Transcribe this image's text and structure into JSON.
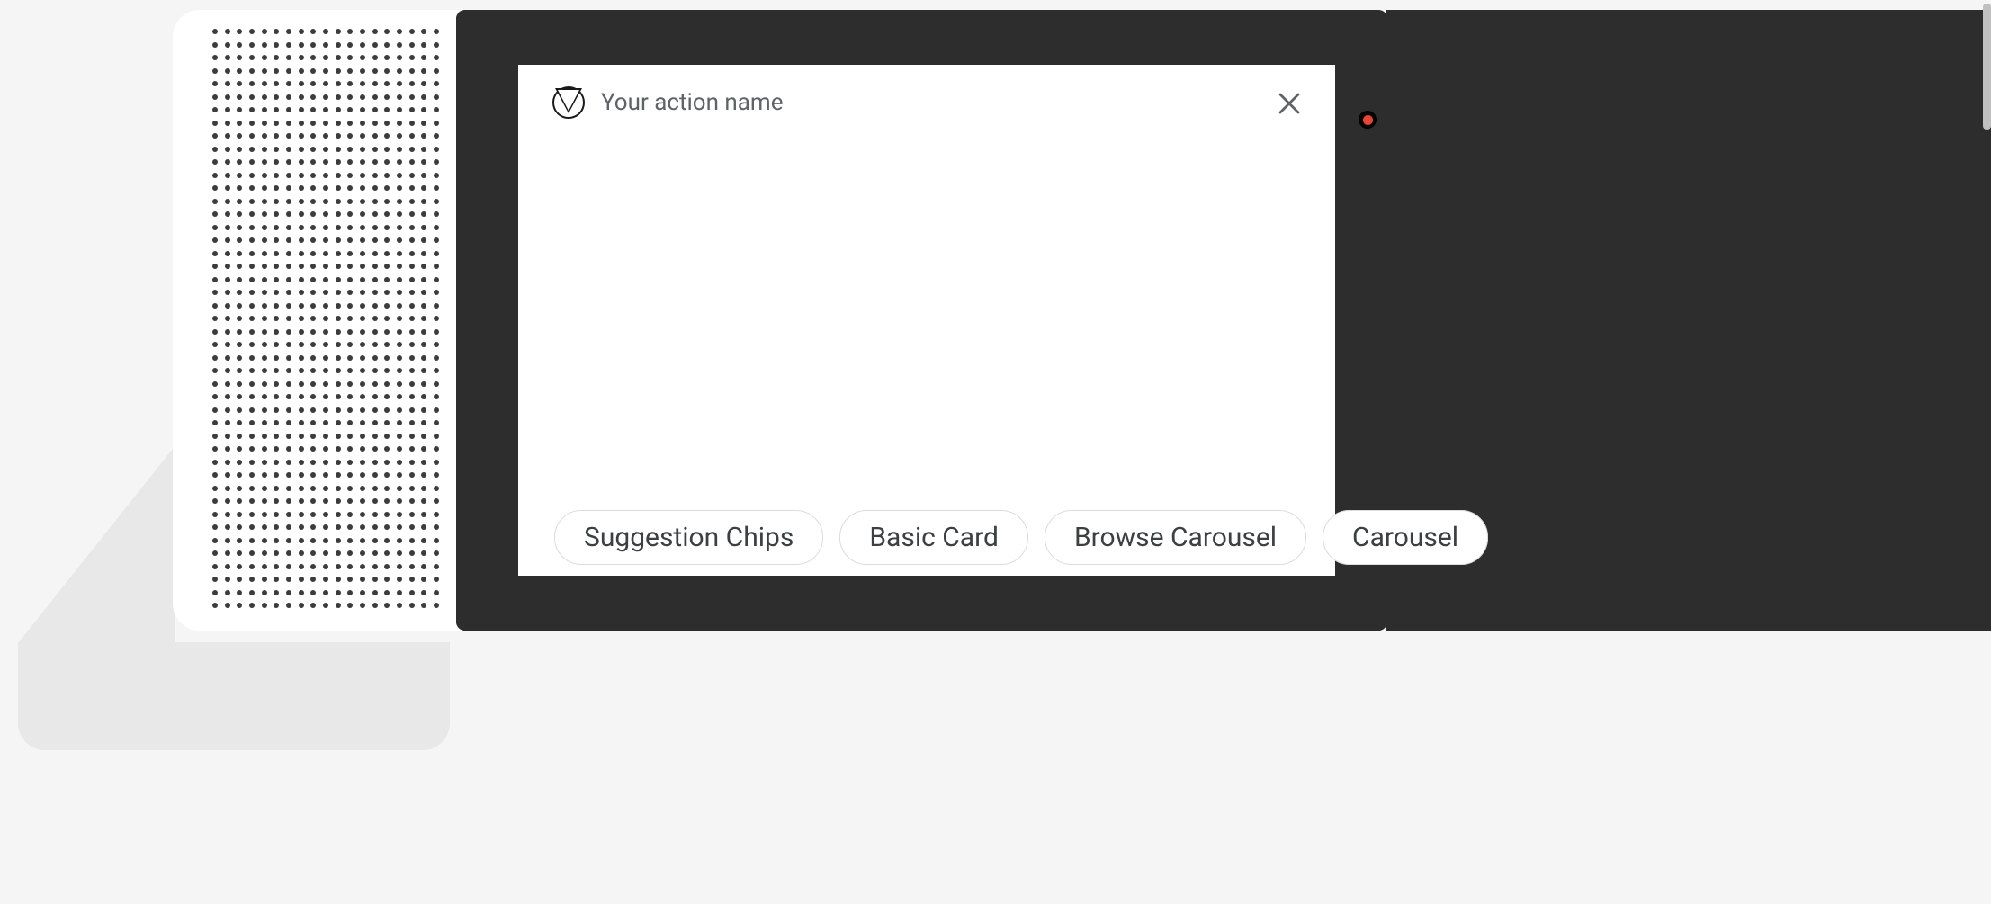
{
  "header": {
    "action_name": "Your action name"
  },
  "chips": [
    {
      "label": "Suggestion Chips"
    },
    {
      "label": "Basic Card"
    },
    {
      "label": "Browse Carousel"
    },
    {
      "label": "Carousel"
    }
  ]
}
